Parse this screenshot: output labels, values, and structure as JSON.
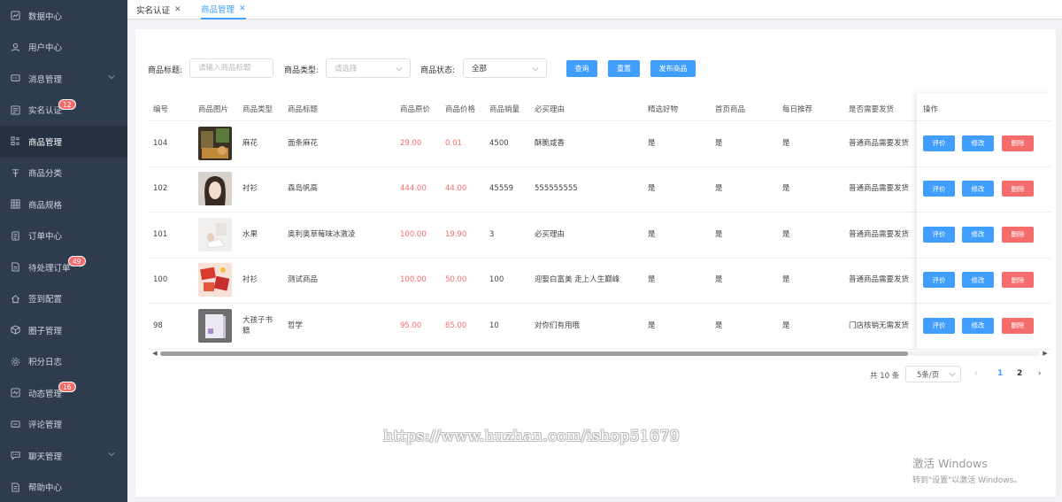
{
  "sidebar": {
    "items": [
      {
        "label": "数据中心",
        "icon": "chart-icon"
      },
      {
        "label": "用户中心",
        "icon": "user-icon"
      },
      {
        "label": "消息管理",
        "icon": "message-icon",
        "has_submenu": true
      },
      {
        "label": "实名认证",
        "icon": "id-card-icon",
        "badge": "12"
      },
      {
        "label": "商品管理",
        "icon": "goods-icon",
        "active": true
      },
      {
        "label": "商品分类",
        "icon": "category-icon"
      },
      {
        "label": "商品规格",
        "icon": "grid-icon"
      },
      {
        "label": "订单中心",
        "icon": "order-icon"
      },
      {
        "label": "待处理订单",
        "icon": "pending-order-icon",
        "badge": "49"
      },
      {
        "label": "签到配置",
        "icon": "home-icon"
      },
      {
        "label": "圈子管理",
        "icon": "cube-icon"
      },
      {
        "label": "积分日志",
        "icon": "settings-icon"
      },
      {
        "label": "动态管理",
        "icon": "activity-icon",
        "badge": "16"
      },
      {
        "label": "评论管理",
        "icon": "comment-icon"
      },
      {
        "label": "聊天管理",
        "icon": "chat-icon",
        "has_submenu": true
      },
      {
        "label": "帮助中心",
        "icon": "help-icon"
      }
    ]
  },
  "tabs": [
    {
      "label": "实名认证",
      "active": false
    },
    {
      "label": "商品管理",
      "active": true
    }
  ],
  "filters": {
    "title_label": "商品标题:",
    "title_placeholder": "请输入商品标题",
    "type_label": "商品类型:",
    "type_placeholder": "请选择",
    "status_label": "商品状态:",
    "status_value": "全部",
    "search_btn": "查询",
    "reset_btn": "重置",
    "publish_btn": "发布商品"
  },
  "table": {
    "headers": [
      "编号",
      "商品图片",
      "商品类型",
      "商品标题",
      "商品原价",
      "商品价格",
      "商品销量",
      "必买理由",
      "精选好物",
      "首页商品",
      "每日推荐",
      "是否需要发货",
      "操作"
    ],
    "rows": [
      {
        "id": "104",
        "type": "麻花",
        "title": "面条麻花",
        "orig_price": "29.00",
        "price": "0.01",
        "sales": "4500",
        "reason": "酥脆咸香",
        "featured": "是",
        "homepage": "是",
        "daily": "是",
        "shipping": "普通商品需要发货"
      },
      {
        "id": "102",
        "type": "衬衫",
        "title": "森岛帆高",
        "orig_price": "444.00",
        "price": "44.00",
        "sales": "45559",
        "reason": "555555555",
        "featured": "是",
        "homepage": "是",
        "daily": "是",
        "shipping": "普通商品需要发货"
      },
      {
        "id": "101",
        "type": "水果",
        "title": "奥利奥草莓味冰激凌",
        "orig_price": "100.00",
        "price": "19.90",
        "sales": "3",
        "reason": "必买理由",
        "featured": "是",
        "homepage": "是",
        "daily": "是",
        "shipping": "普通商品需要发货"
      },
      {
        "id": "100",
        "type": "衬衫",
        "title": "测试商品",
        "orig_price": "100.00",
        "price": "50.00",
        "sales": "100",
        "reason": "迎娶白富美 走上人生巅峰",
        "featured": "是",
        "homepage": "是",
        "daily": "是",
        "shipping": "普通商品需要发货"
      },
      {
        "id": "98",
        "type": "大孩子书\n籍",
        "title": "哲学",
        "orig_price": "95.00",
        "price": "85.00",
        "sales": "10",
        "reason": "对你们有用哦",
        "featured": "是",
        "homepage": "是",
        "daily": "是",
        "shipping": "门店核销无需发货"
      }
    ],
    "actions": {
      "review": "评价",
      "edit": "修改",
      "delete": "删除"
    }
  },
  "pagination": {
    "total": "共 10 条",
    "page_size": "5条/页",
    "pages": [
      "1",
      "2"
    ],
    "current": "1"
  },
  "colors": {
    "primary": "#409eff",
    "danger": "#f56c6c",
    "sidebar": "#2f3c4d"
  },
  "watermark": "https://www.huzhan.com/ishop51679",
  "os_notice": {
    "title": "激活 Windows",
    "subtitle": "转到\"设置\"以激活 Windows。"
  }
}
